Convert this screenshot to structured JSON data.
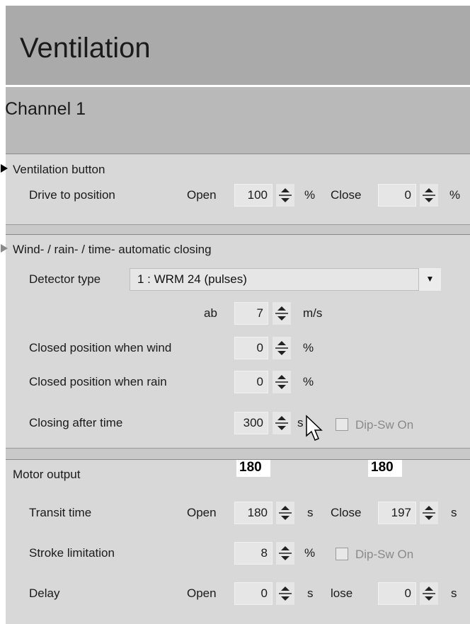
{
  "header": {
    "title": "Ventilation",
    "channel": "Channel 1"
  },
  "ventilation_button": {
    "heading": "Ventilation button",
    "drive_label": "Drive to position",
    "open_label": "Open",
    "open_value": "100",
    "open_unit": "%",
    "close_label": "Close",
    "close_value": "0",
    "close_unit": "%"
  },
  "auto_closing": {
    "heading": "Wind- / rain- / time-  automatic closing",
    "detector_label": "Detector type",
    "detector_value": "1 : WRM 24   (pulses)",
    "ab_label": "ab",
    "ab_value": "7",
    "ab_unit": "m/s",
    "wind_label": "Closed position when wind",
    "wind_value": "0",
    "wind_unit": "%",
    "rain_label": "Closed position when rain",
    "rain_value": "0",
    "rain_unit": "%",
    "time_label": "Closing after time",
    "time_value": "300",
    "time_unit": "s",
    "dipsw_label": "Dip-Sw On"
  },
  "motor_output": {
    "heading": "Motor output",
    "readout_open": "180",
    "readout_close": "180",
    "transit_label": "Transit time",
    "transit_open_label": "Open",
    "transit_open_value": "180",
    "transit_open_unit": "s",
    "transit_close_label": "Close",
    "transit_close_value": "197",
    "transit_close_unit": "s",
    "stroke_label": "Stroke limitation",
    "stroke_value": "8",
    "stroke_unit": "%",
    "stroke_dipsw_label": "Dip-Sw On",
    "delay_label": "Delay",
    "delay_open_label": "Open",
    "delay_open_value": "0",
    "delay_open_unit": "s",
    "delay_close_label": "lose",
    "delay_close_value": "0",
    "delay_close_unit": "s"
  },
  "colors": {
    "header_bg": "#aaaaaa",
    "section_bg": "#d8d8d8",
    "field_bg": "#e6e6e6"
  }
}
